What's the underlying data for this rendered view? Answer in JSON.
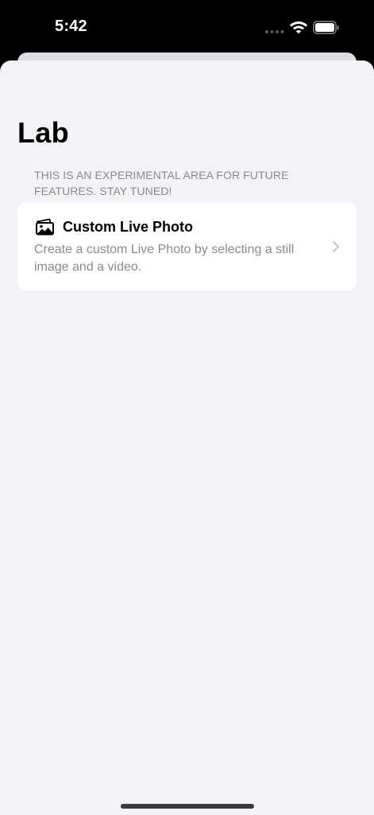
{
  "status_bar": {
    "time": "5:42"
  },
  "page": {
    "title": "Lab",
    "section_header": "THIS IS AN EXPERIMENTAL AREA FOR FUTURE FEATURES. STAY TUNED!"
  },
  "items": [
    {
      "title": "Custom Live Photo",
      "description": "Create a custom Live Photo by selecting a still image and a video.",
      "icon": "photo-stack-icon"
    }
  ],
  "colors": {
    "background": "#f2f2f7",
    "card": "#ffffff",
    "secondary_text": "#8a8a8e",
    "chevron": "#c4c4c7"
  }
}
